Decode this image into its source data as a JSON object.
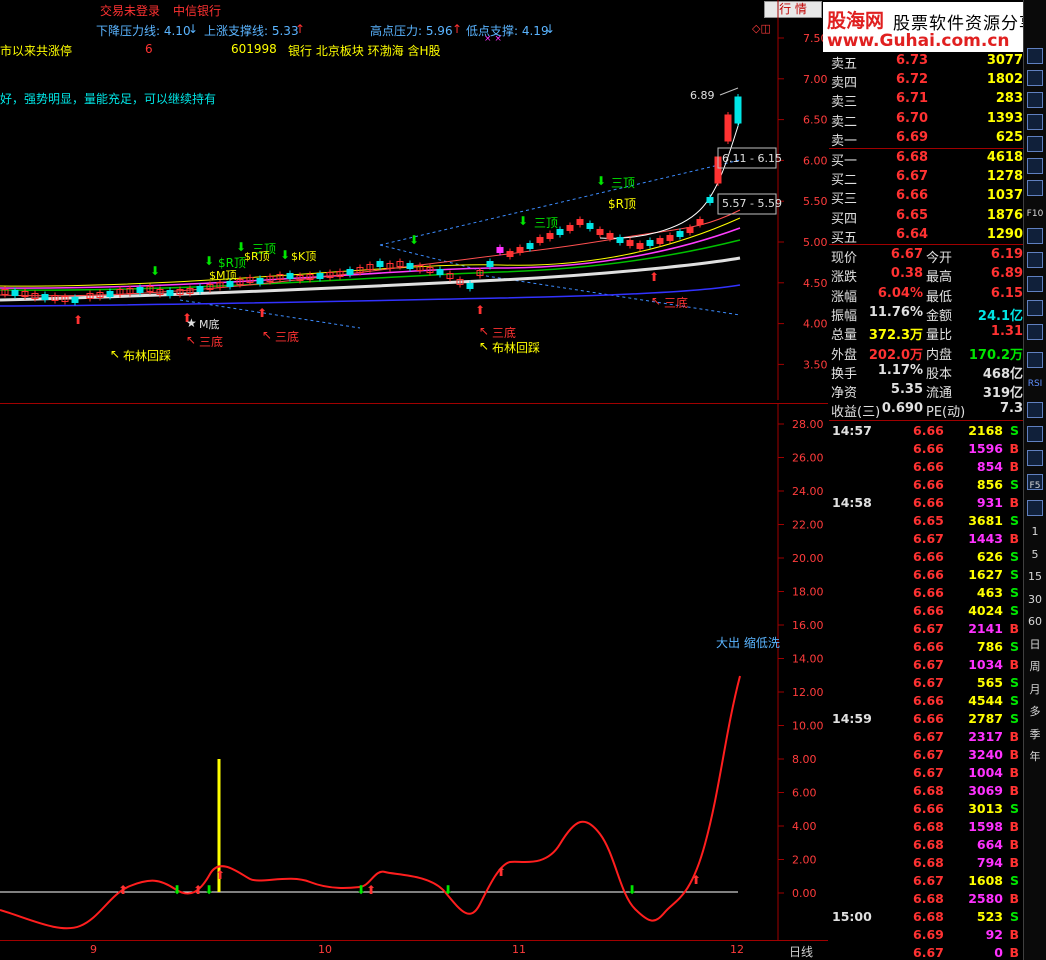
{
  "topbar": {
    "login_status": "交易未登录",
    "broker": "中信银行",
    "down_pressure": "下降压力线: 4.10",
    "up_support": "上涨支撑线: 5.33",
    "high_pressure": "高点压力: 5.96",
    "low_support": "低点支撑: 4.19",
    "quote_button": "行  情"
  },
  "info_lines": {
    "line1_label": "市以来共涨停",
    "line1_count": "6",
    "line1_code": "601998",
    "line1_blocks": "银行 北京板块 环渤海 含H股",
    "line2": "好，强势明显，量能充足，可以继续持有"
  },
  "main_chart": {
    "y_ticks": [
      "7.50",
      "7.00",
      "6.50",
      "6.00",
      "5.50",
      "5.00",
      "4.50",
      "4.00",
      "3.50"
    ],
    "annotations": {
      "peak": "6.89",
      "range1": "6.11 - 6.15",
      "range2": "5.57 - 5.59",
      "sanding1": "三顶",
      "sanding2": "三顶",
      "sanding3": "三顶",
      "srding": "$R顶",
      "smding": "$M顶",
      "srding2": "$R顶",
      "skding": "$K顶",
      "srding3": "$R顶",
      "mdi": "M底",
      "sandi1": "三底",
      "sandi2": "三底",
      "sandi3": "三底",
      "sandi4": "三底",
      "bulin1": "布林回踩",
      "bulin2": "布林回踩"
    }
  },
  "sub_chart": {
    "y_ticks": [
      "28.00",
      "26.00",
      "24.00",
      "22.00",
      "20.00",
      "18.00",
      "16.00",
      "14.00",
      "12.00",
      "10.00",
      "8.00",
      "6.00",
      "4.00",
      "2.00",
      "0.00"
    ],
    "annotation": "大出 缩低洗"
  },
  "x_axis": {
    "labels": [
      "9",
      "10",
      "11",
      "12"
    ],
    "period": "日线"
  },
  "logo": {
    "name": "股海网",
    "slogan": "股票软件资源分享",
    "url": "www.Guhai.com.cn"
  },
  "order_book": {
    "asks": [
      {
        "label": "卖五",
        "price": "6.73",
        "vol": "3077"
      },
      {
        "label": "卖四",
        "price": "6.72",
        "vol": "1802"
      },
      {
        "label": "卖三",
        "price": "6.71",
        "vol": "283"
      },
      {
        "label": "卖二",
        "price": "6.70",
        "vol": "1393"
      },
      {
        "label": "卖一",
        "price": "6.69",
        "vol": "625"
      }
    ],
    "bids": [
      {
        "label": "买一",
        "price": "6.68",
        "vol": "4618"
      },
      {
        "label": "买二",
        "price": "6.67",
        "vol": "1278"
      },
      {
        "label": "买三",
        "price": "6.66",
        "vol": "1037"
      },
      {
        "label": "买四",
        "price": "6.65",
        "vol": "1876"
      },
      {
        "label": "买五",
        "price": "6.64",
        "vol": "1290"
      }
    ]
  },
  "stats": [
    {
      "l1": "现价",
      "v1": "6.67",
      "l2": "今开",
      "v2": "6.19"
    },
    {
      "l1": "涨跌",
      "v1": "0.38",
      "l2": "最高",
      "v2": "6.89"
    },
    {
      "l1": "涨幅",
      "v1": "6.04%",
      "l2": "最低",
      "v2": "6.15"
    },
    {
      "l1": "振幅",
      "v1": "11.76%",
      "l2": "金额",
      "v2": "24.1亿"
    },
    {
      "l1": "总量",
      "v1": "372.3万",
      "l2": "量比",
      "v2": "1.31"
    },
    {
      "l1": "外盘",
      "v1": "202.0万",
      "l2": "内盘",
      "v2": "170.2万"
    },
    {
      "l1": "换手",
      "v1": "1.17%",
      "l2": "股本",
      "v2": "468亿"
    },
    {
      "l1": "净资",
      "v1": "5.35",
      "l2": "流通",
      "v2": "319亿"
    },
    {
      "l1": "收益(三)",
      "v1": "0.690",
      "l2": "PE(动)",
      "v2": "7.3"
    }
  ],
  "ticks": [
    {
      "t": "14:57",
      "p": "6.66",
      "v": "2168",
      "s": "S"
    },
    {
      "t": "",
      "p": "6.66",
      "v": "1596",
      "s": "B"
    },
    {
      "t": "",
      "p": "6.66",
      "v": "854",
      "s": "B"
    },
    {
      "t": "",
      "p": "6.66",
      "v": "856",
      "s": "S"
    },
    {
      "t": "14:58",
      "p": "6.66",
      "v": "931",
      "s": "B"
    },
    {
      "t": "",
      "p": "6.65",
      "v": "3681",
      "s": "S"
    },
    {
      "t": "",
      "p": "6.67",
      "v": "1443",
      "s": "B"
    },
    {
      "t": "",
      "p": "6.66",
      "v": "626",
      "s": "S"
    },
    {
      "t": "",
      "p": "6.66",
      "v": "1627",
      "s": "S"
    },
    {
      "t": "",
      "p": "6.66",
      "v": "463",
      "s": "S"
    },
    {
      "t": "",
      "p": "6.66",
      "v": "4024",
      "s": "S"
    },
    {
      "t": "",
      "p": "6.67",
      "v": "2141",
      "s": "B"
    },
    {
      "t": "",
      "p": "6.66",
      "v": "786",
      "s": "S"
    },
    {
      "t": "",
      "p": "6.67",
      "v": "1034",
      "s": "B"
    },
    {
      "t": "",
      "p": "6.67",
      "v": "565",
      "s": "S"
    },
    {
      "t": "",
      "p": "6.66",
      "v": "4544",
      "s": "S"
    },
    {
      "t": "14:59",
      "p": "6.66",
      "v": "2787",
      "s": "S"
    },
    {
      "t": "",
      "p": "6.67",
      "v": "2317",
      "s": "B"
    },
    {
      "t": "",
      "p": "6.67",
      "v": "3240",
      "s": "B"
    },
    {
      "t": "",
      "p": "6.67",
      "v": "1004",
      "s": "B"
    },
    {
      "t": "",
      "p": "6.68",
      "v": "3069",
      "s": "B"
    },
    {
      "t": "",
      "p": "6.66",
      "v": "3013",
      "s": "S"
    },
    {
      "t": "",
      "p": "6.68",
      "v": "1598",
      "s": "B"
    },
    {
      "t": "",
      "p": "6.68",
      "v": "664",
      "s": "B"
    },
    {
      "t": "",
      "p": "6.68",
      "v": "794",
      "s": "B"
    },
    {
      "t": "",
      "p": "6.67",
      "v": "1608",
      "s": "S"
    },
    {
      "t": "",
      "p": "6.68",
      "v": "2580",
      "s": "B"
    },
    {
      "t": "15:00",
      "p": "6.68",
      "v": "523",
      "s": "S"
    },
    {
      "t": "",
      "p": "6.69",
      "v": "92",
      "s": "B"
    },
    {
      "t": "",
      "p": "6.67",
      "v": "0",
      "s": "B"
    }
  ],
  "sidebar": {
    "items": [
      "1",
      "5",
      "15",
      "30",
      "60",
      "日",
      "周",
      "月",
      "多",
      "季",
      "年"
    ],
    "icons": [
      "F10",
      "RSI",
      "F5"
    ]
  },
  "colors": {
    "up": "#ff3232",
    "down": "#00e600",
    "bg": "#000000",
    "axis": "#a00000"
  }
}
